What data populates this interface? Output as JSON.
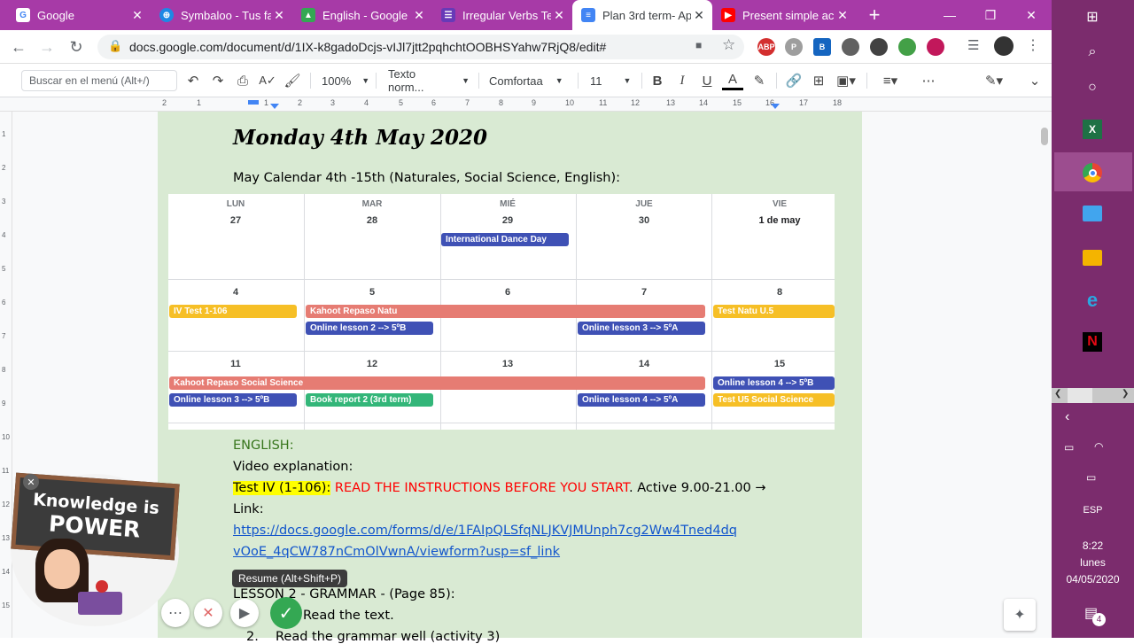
{
  "tabs": [
    {
      "label": "Google",
      "icon": "google-icon",
      "color": "#4285f4"
    },
    {
      "label": "Symbaloo - Tus fa",
      "icon": "symbaloo-icon",
      "color": "#1e88e5"
    },
    {
      "label": "English - Google I",
      "icon": "google-drive-icon",
      "color": "#34a853"
    },
    {
      "label": "Irregular Verbs Te",
      "icon": "google-forms-icon",
      "color": "#673ab7"
    },
    {
      "label": "Plan 3rd term- Ap",
      "icon": "google-docs-icon",
      "color": "#4285f4"
    },
    {
      "label": "Present simple ac",
      "icon": "youtube-icon",
      "color": "#ff0000"
    }
  ],
  "address": {
    "url": "docs.google.com/document/d/1IX-k8gadoDcjs-vIJl7jtt2pqhchtOOBHSYahw7RjQ8/edit#"
  },
  "extensions": [
    {
      "label": "ABP",
      "color": "#d32f2f"
    },
    {
      "label": "P",
      "color": "#9e9e9e"
    },
    {
      "label": "B",
      "color": "#1565c0"
    },
    {
      "label": "",
      "color": "#616161"
    },
    {
      "label": "",
      "color": "#424242"
    },
    {
      "label": "",
      "color": "#43a047"
    },
    {
      "label": "",
      "color": "#c2185b"
    }
  ],
  "toolbar": {
    "menu_search_placeholder": "Buscar en el menú (Alt+/)",
    "zoom": "100%",
    "style": "Texto norm...",
    "font": "Comfortaa",
    "size": "11"
  },
  "ruler_numbers": [
    "2",
    "1",
    "1",
    "2",
    "3",
    "4",
    "5",
    "6",
    "7",
    "8",
    "9",
    "10",
    "11",
    "12",
    "13",
    "14",
    "15",
    "16",
    "17",
    "18"
  ],
  "left_ruler_numbers": [
    "1",
    "2",
    "3",
    "4",
    "5",
    "6",
    "7",
    "8",
    "9",
    "10",
    "11",
    "12",
    "13",
    "14",
    "15"
  ],
  "doc": {
    "title": "Monday 4th May 2020",
    "calendar_heading": "May Calendar 4th -15th (Naturales, Social Science, English):",
    "english_label": "ENGLISH:",
    "video_label": "Video explanation:",
    "test_label": "Test IV (1-106):",
    "test_instructions": "READ THE INSTRUCTIONS BEFORE YOU START",
    "test_active": ". Active 9.00-21.00 →",
    "link_label": "Link:",
    "link_line1": "https://docs.google.com/forms/d/e/1FAIpQLSfqNLJKVJMUnph7cg2Ww4Tned4dq",
    "link_line2": "vOoE_4qCW787nCmOlVwnA/viewform?usp=sf_link",
    "lesson_heading": "LESSON 2 - GRAMMAR - (Page 85):",
    "list_item_1": "Read the text.",
    "list_item_2_num": "2.",
    "list_item_2": "Read the grammar well (activity 3)"
  },
  "calendar": {
    "headers": [
      "LUN",
      "MAR",
      "MIÉ",
      "JUE",
      "VIE"
    ],
    "week1": [
      "27",
      "28",
      "29",
      "30",
      "1 de may"
    ],
    "week2": [
      "4",
      "5",
      "6",
      "7",
      "8"
    ],
    "week3": [
      "11",
      "12",
      "13",
      "14",
      "15"
    ],
    "events": {
      "dance": "International Dance Day",
      "test_iv": "IV Test 1-106",
      "kahoot_natu": "Kahoot Repaso Natu",
      "test_natu": "Test Natu U.5",
      "online2": "Online lesson 2 --> 5ºB",
      "online3a": "Online lesson 3 --> 5ºA",
      "kahoot_ss": "Kahoot Repaso Social Science",
      "online4b": "Online lesson 4 --> 5ºB",
      "online3b": "Online lesson 3 --> 5ºB",
      "book_report": "Book report 2 (3rd term)",
      "online4a": "Online lesson 4 --> 5ºA",
      "test_u5": "Test U5 Social Science"
    }
  },
  "recorder": {
    "sign_line1": "Knowledge is",
    "sign_line2": "POWER",
    "tooltip": "Resume (Alt+Shift+P)"
  },
  "taskbar": {
    "lang": "ESP",
    "time": "8:22",
    "day": "lunes",
    "date": "04/05/2020",
    "notif_count": "4"
  }
}
